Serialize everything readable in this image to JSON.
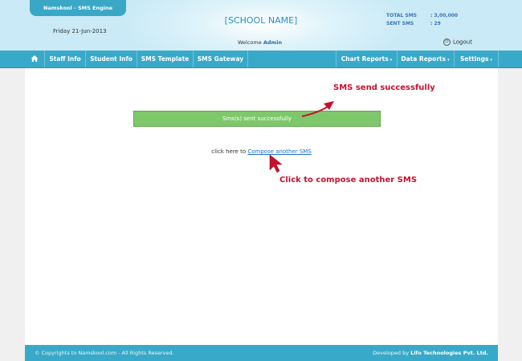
{
  "header": {
    "brand": "Namskool - SMS Engine",
    "date": "Friday 21-Jun-2013",
    "school_name": "[SCHOOL NAME]",
    "welcome_prefix": "Welcome",
    "welcome_user": "Admin",
    "stats": [
      {
        "label": "TOTAL SMS",
        "value": ": 3,00,000"
      },
      {
        "label": "SENT SMS",
        "value": ": 29"
      }
    ],
    "logout_label": "Logout"
  },
  "nav": {
    "home_icon": "home-icon",
    "left_items": [
      "Staff Info",
      "Student Info",
      "SMS Template",
      "SMS Gateway"
    ],
    "right_items": [
      "Chart Reports",
      "Data Reports",
      "Settings"
    ],
    "caret": "▾"
  },
  "main": {
    "success_message": "Sms(s) sent successfully",
    "compose_prefix": "click here to",
    "compose_link": "Compose another SMS"
  },
  "annotations": {
    "top": "SMS send successfully",
    "bottom": "Click to compose another SMS",
    "color": "#c8102e"
  },
  "footer": {
    "copyright": "© Copyrights to Namskool.com - All Rights Reserved.",
    "developed_prefix": "Developed by",
    "developer": "Lifo Technologies Pvt. Ltd."
  },
  "colors": {
    "nav_bg": "#39a9c9",
    "success_bg": "#7ec86b",
    "link": "#1a6fd0"
  }
}
